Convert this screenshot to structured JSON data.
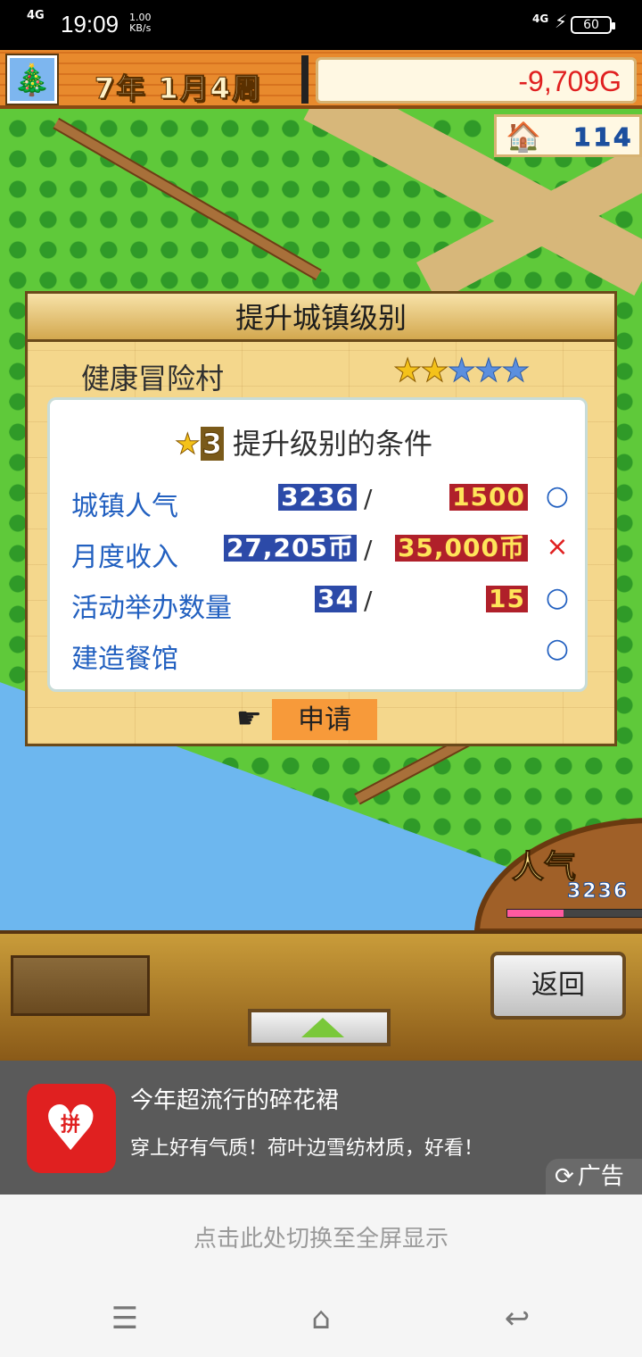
{
  "status_bar": {
    "network": "4G",
    "time": "19:09",
    "speed": "1.00",
    "speed_unit": "KB/s",
    "network2": "4G",
    "battery": "60"
  },
  "game": {
    "date": "7年 1月4周",
    "money": "-9,709G",
    "population": "114",
    "dialog": {
      "title": "提升城镇级别",
      "town_name": "健康冒险村",
      "stars_filled": 2,
      "stars_total": 5,
      "conditions_level": "3",
      "conditions_title": "提升级别的条件",
      "rows": [
        {
          "label": "城镇人气",
          "current": "3236",
          "slash": "/",
          "target": "1500",
          "status": "○"
        },
        {
          "label": "月度收入",
          "current": "27,205币",
          "slash": "/",
          "target": "35,000币",
          "status": "×"
        },
        {
          "label": "活动举办数量",
          "current": "34",
          "slash": "/",
          "target": "15",
          "status": "○"
        },
        {
          "label": "建造餐馆",
          "current": "",
          "slash": "",
          "target": "",
          "status": "○"
        }
      ],
      "apply_label": "申请"
    },
    "popularity_label": "人气",
    "popularity_value": "3236",
    "popularity_fraction": 0.4,
    "back_label": "返回"
  },
  "ad": {
    "logo_char": "拼",
    "title": "今年超流行的碎花裙",
    "desc": "穿上好有气质！荷叶边雪纺材质，好看！",
    "badge": "广告"
  },
  "switch_text": "点击此处切换至全屏显示",
  "navbar": {
    "menu": "☰",
    "home": "⌂",
    "back": "↩"
  }
}
